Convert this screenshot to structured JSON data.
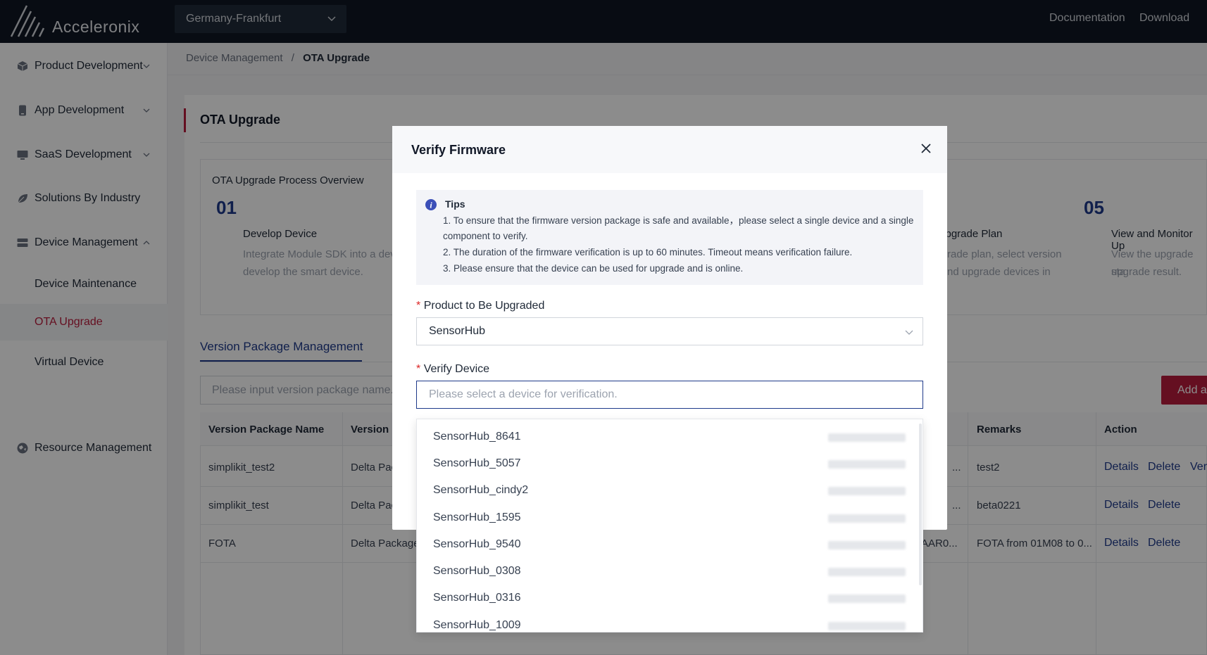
{
  "brand": {
    "name": "Acceleronix"
  },
  "header": {
    "region": "Germany-Frankfurt",
    "links": [
      "Documentation",
      "Download"
    ]
  },
  "sidebar": {
    "items": [
      {
        "label": "Product Development",
        "icon": "cube-icon"
      },
      {
        "label": "App Development",
        "icon": "phone-icon"
      },
      {
        "label": "SaaS Development",
        "icon": "monitor-icon"
      },
      {
        "label": "Solutions By Industry",
        "icon": "leaf-icon"
      },
      {
        "label": "Device Management",
        "icon": "server-icon"
      }
    ],
    "sub_items": [
      "Device Maintenance",
      "OTA Upgrade",
      "Virtual Device"
    ],
    "resource": {
      "label": "Resource Management",
      "icon": "globe-icon"
    }
  },
  "breadcrumb": {
    "parent": "Device Management",
    "sep": "/",
    "current": "OTA Upgrade"
  },
  "page": {
    "title": "OTA Upgrade"
  },
  "overview": {
    "title": "OTA Upgrade Process Overview",
    "steps": [
      {
        "num": "01",
        "heading": "Develop Device",
        "desc1": "Integrate Module SDK into a dev",
        "desc2": "develop the smart device."
      },
      {
        "num": "05",
        "heading": "View and Monitor Up",
        "desc1": "View the upgrade sta",
        "desc2": "upgrade result."
      }
    ],
    "partial": {
      "heading": "Jpgrade Plan",
      "desc1": "rade plan, select version",
      "desc2": "nd upgrade devices in"
    }
  },
  "tabs": {
    "active": "Version Package Management"
  },
  "search": {
    "placeholder": "Please input version package name."
  },
  "add_button": "Add a",
  "table": {
    "headers": {
      "name": "Version Package Name",
      "type": "Version I",
      "remarks": "Remarks",
      "action": "Action"
    },
    "rows": [
      {
        "name": "simplikit_test2",
        "type": "Delta Pac",
        "file": "...",
        "remarks": "test2",
        "actions": [
          "Details",
          "Delete",
          "Veri"
        ]
      },
      {
        "name": "simplikit_test",
        "type": "Delta Pac",
        "file": "...",
        "remarks": "beta0221",
        "actions": [
          "Details",
          "Delete"
        ]
      },
      {
        "name": "FOTA",
        "type": "Delta Package",
        "file": "AAR0...",
        "remarks": "FOTA from 01M08 to 0...",
        "actions": [
          "Details",
          "Delete"
        ]
      }
    ]
  },
  "modal": {
    "title": "Verify Firmware",
    "tips": {
      "title": "Tips",
      "line1a": "1. To ensure that the firmware version package is safe and available，please select a single device and a single",
      "line1b": "component to verify.",
      "line2": "2. The duration of the firmware verification is up to 60 minutes. Timeout means verification failure.",
      "line3": "3. Please ensure that the device can be used for upgrade and is online."
    },
    "product_label": "Product to Be Upgraded",
    "product_value": "SensorHub",
    "device_label": "Verify Device",
    "device_placeholder": "Please select a device for verification."
  },
  "dropdown": {
    "options": [
      "SensorHub_8641",
      "SensorHub_5057",
      "SensorHub_cindy2",
      "SensorHub_1595",
      "SensorHub_9540",
      "SensorHub_0308",
      "SensorHub_0316",
      "SensorHub_1009"
    ]
  },
  "colors": {
    "brand": "#b91c3c",
    "link": "#1e3a8a",
    "topbar": "#0f1724"
  }
}
